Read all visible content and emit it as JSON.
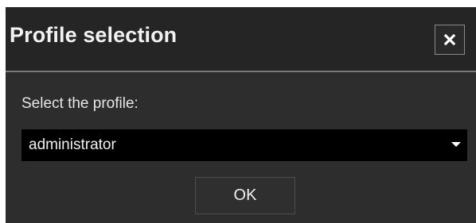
{
  "dialog": {
    "title": "Profile selection",
    "close_icon": "close-icon",
    "prompt_label": "Select the profile:",
    "profile_select": {
      "selected_value": "administrator",
      "arrow_icon": "chevron-down-icon"
    },
    "ok_label": "OK"
  },
  "colors": {
    "title_background": "#252525",
    "body_background": "#2d2d2d",
    "select_background": "#000000",
    "text": "#f0f0f0"
  }
}
